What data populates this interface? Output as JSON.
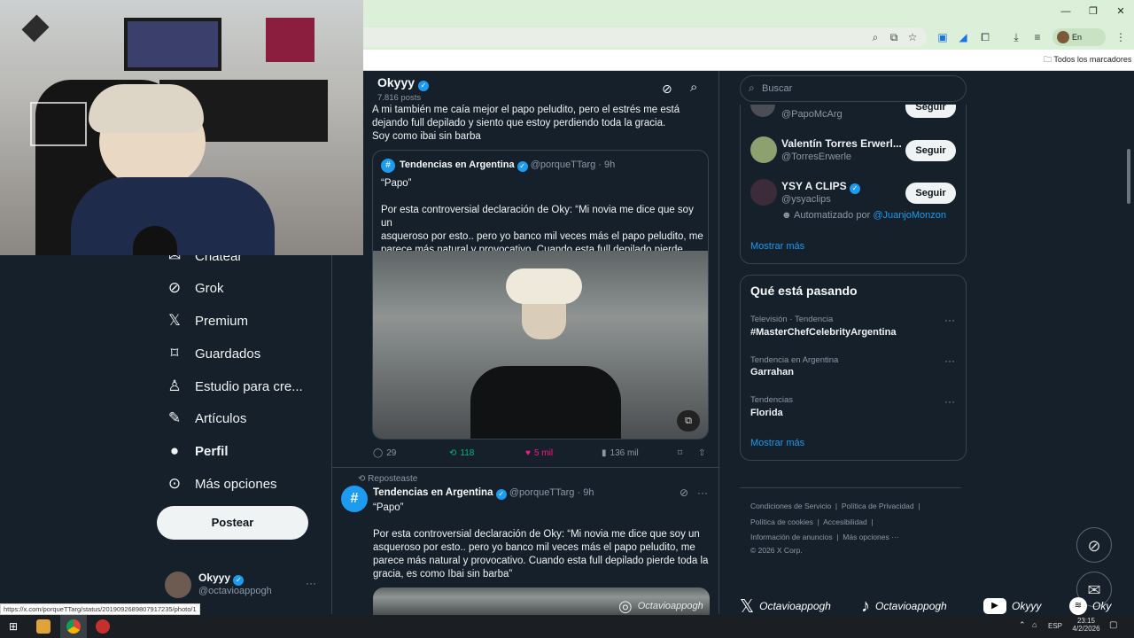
{
  "browser": {
    "profile_status": "En pausa",
    "bookmarks_all": "Todos los marcadores",
    "status_url": "https://x.com/porqueTTarg/status/2019092689807917235/photo/1"
  },
  "header": {
    "name": "Okyyy",
    "posts": "7.816 posts"
  },
  "nav": {
    "chatear": "Chatear",
    "grok": "Grok",
    "premium": "Premium",
    "guardados": "Guardados",
    "estudio": "Estudio para cre...",
    "articulos": "Artículos",
    "perfil": "Perfil",
    "mas": "Más opciones",
    "post_button": "Postear"
  },
  "account": {
    "name": "Okyyy",
    "handle": "@octavioappogh"
  },
  "tweet1": {
    "text_line1": "A mi también me caía mejor el papo peludito, pero el estrés me está",
    "text_line2": "dejando full depilado y siento que estoy perdiendo toda la gracia.",
    "text_line3": "Soy como ibai sin barba",
    "quote": {
      "name": "Tendencias en Argentina",
      "handle_time": "@porqueTTarg · 9h",
      "line1": "“Papo”",
      "line2": "Por esta controversial declaración de Oky: “Mi novia me dice que soy un",
      "line3": "asqueroso por esto.. pero yo banco mil veces más el papo peludito, me",
      "line4": "parece más natural y provocativo. Cuando esta full depilado pierde ..."
    },
    "replies": "29",
    "reposts": "118",
    "likes": "5 mil",
    "views": "136 mil"
  },
  "tweet2": {
    "repost_label": "Reposteaste",
    "name": "Tendencias en Argentina",
    "handle_time": "@porqueTTarg · 9h",
    "line1": "“Papo”",
    "line2": "Por esta controversial declaración de Oky: “Mi novia me dice que soy un",
    "line3": "asqueroso por esto.. pero yo banco mil veces más el papo peludito, me",
    "line4": "parece más natural y provocativo. Cuando esta full depilado pierde toda la",
    "line5": "gracia, es como Ibai sin barba”"
  },
  "search": {
    "placeholder": "Buscar"
  },
  "suggestions": {
    "items": [
      {
        "name": "",
        "handle": "@PapoMcArg",
        "button": "Seguir"
      },
      {
        "name": "Valentín Torres Erwerl...",
        "handle": "@TorresErwerle",
        "button": "Seguir"
      },
      {
        "name": "YSY A CLIPS",
        "handle": "@ysyaclips",
        "button": "Seguir",
        "automated_prefix": "Automatizado por",
        "automated_by": "@JuanjoMonzon"
      }
    ],
    "show_more": "Mostrar más"
  },
  "trends": {
    "title": "Qué está pasando",
    "items": [
      {
        "category": "Televisión · Tendencia",
        "name": "#MasterChefCelebrityArgentina"
      },
      {
        "category": "Tendencia en Argentina",
        "name": "Garrahan"
      },
      {
        "category": "Tendencias",
        "name": "Florida"
      }
    ],
    "show_more": "Mostrar más"
  },
  "footer": {
    "terms": "Condiciones de Servicio",
    "privacy": "Política de Privacidad",
    "cookies": "Política de cookies",
    "accessibility": "Accesibilidad",
    "ads": "Información de anuncios",
    "more": "Más opciones ···",
    "copyright": "© 2026 X Corp."
  },
  "overlay": {
    "x_handle": "Octavioappogh",
    "tiktok_handle": "Octavioappogh",
    "youtube_handle": "Okyyy",
    "spotify_handle": "Oky",
    "watermark": "Octavioappogh"
  },
  "taskbar": {
    "lang": "ESP",
    "time": "23:15",
    "date": "4/2/2026"
  },
  "colors": {
    "background": "#15202b",
    "accent": "#1d9bf0",
    "like": "#f91880",
    "repost": "#00ba7c"
  }
}
